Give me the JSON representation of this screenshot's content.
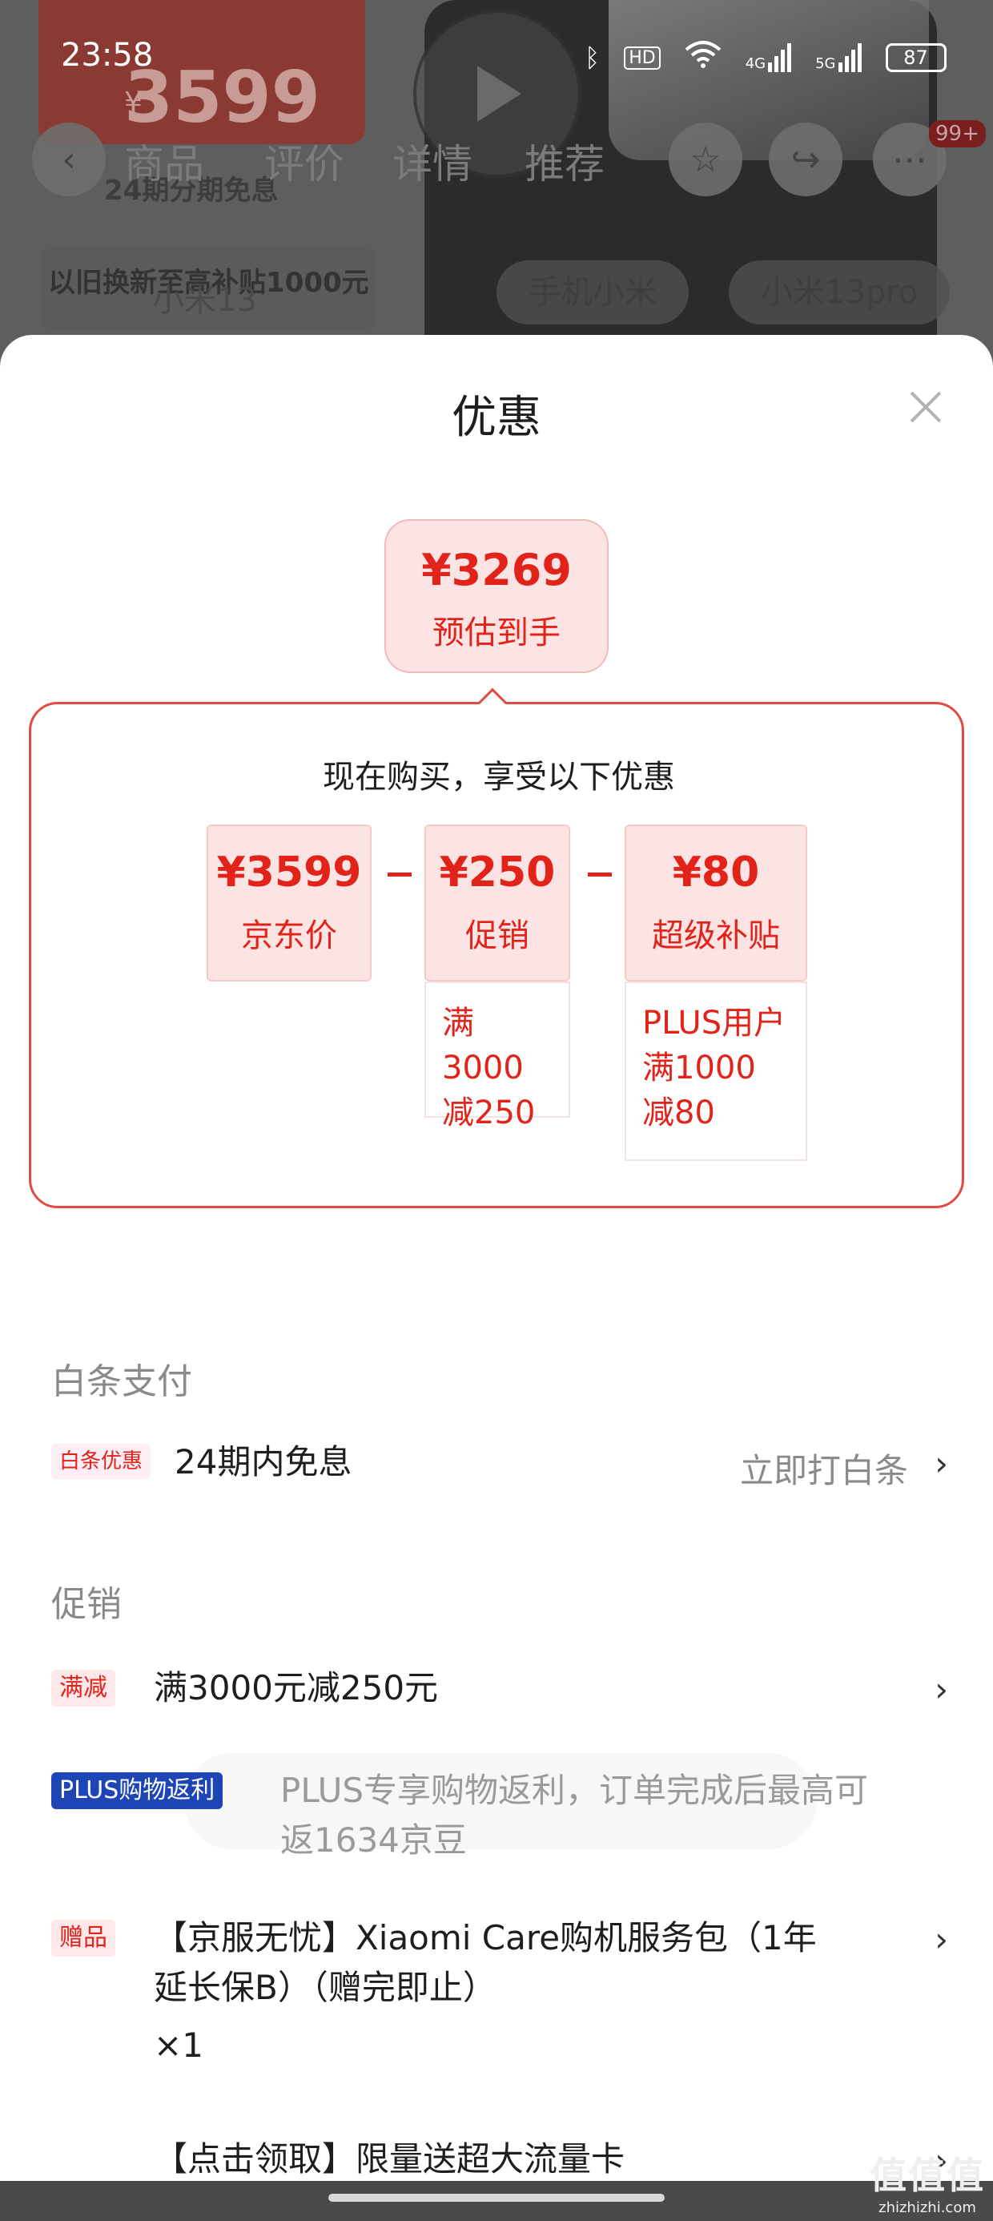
{
  "status_bar": {
    "time": "23:58",
    "battery": "87",
    "hd": "HD",
    "net1": "4G",
    "net2": "5G"
  },
  "background": {
    "price": "3599",
    "currency": "¥",
    "installment": "24期分期免息",
    "tradein": "以旧换新至高补贴1000元",
    "tabs": [
      "商品",
      "评价",
      "详情",
      "推荐"
    ],
    "badge": "99+",
    "search": "小米13",
    "chips": [
      "手机小米",
      "小米13pro"
    ]
  },
  "sheet": {
    "title": "优惠",
    "estimate": {
      "price": "¥3269",
      "label": "预估到手"
    },
    "frame_heading": "现在购买，享受以下优惠",
    "calc": [
      {
        "amount": "¥3599",
        "label": "京东价",
        "note": ""
      },
      {
        "amount": "¥250",
        "label": "促销",
        "note_lines": [
          "满3000",
          "减250"
        ]
      },
      {
        "amount": "¥80",
        "label": "超级补贴",
        "note_lines": [
          "PLUS用户",
          "满1000",
          "减80"
        ]
      }
    ],
    "baitiao": {
      "section": "白条支付",
      "tag": "白条优惠",
      "text": "24期内免息",
      "action": "立即打白条"
    },
    "promo": {
      "section": "促销",
      "items": [
        {
          "tag": "满减",
          "text": "满3000元减250元"
        },
        {
          "tag": "PLUS购物返利",
          "text_line1": "PLUS专享购物返利，订单完成后最高可",
          "text_line2": "返1634京豆"
        },
        {
          "tag": "赠品",
          "text_line1": "【京服无忧】Xiaomi Care购机服务包（1年",
          "text_line2": "延长保B）（赠完即止）",
          "qty": "×1"
        },
        {
          "text": "【点击领取】限量送超大流量卡"
        }
      ]
    }
  },
  "watermark": {
    "mark": "值值值",
    "url": "zhizhizhi.com"
  },
  "colors": {
    "accent": "#e2231a",
    "pink_bg": "#fde4e4",
    "plus_blue": "#1e45b5"
  }
}
